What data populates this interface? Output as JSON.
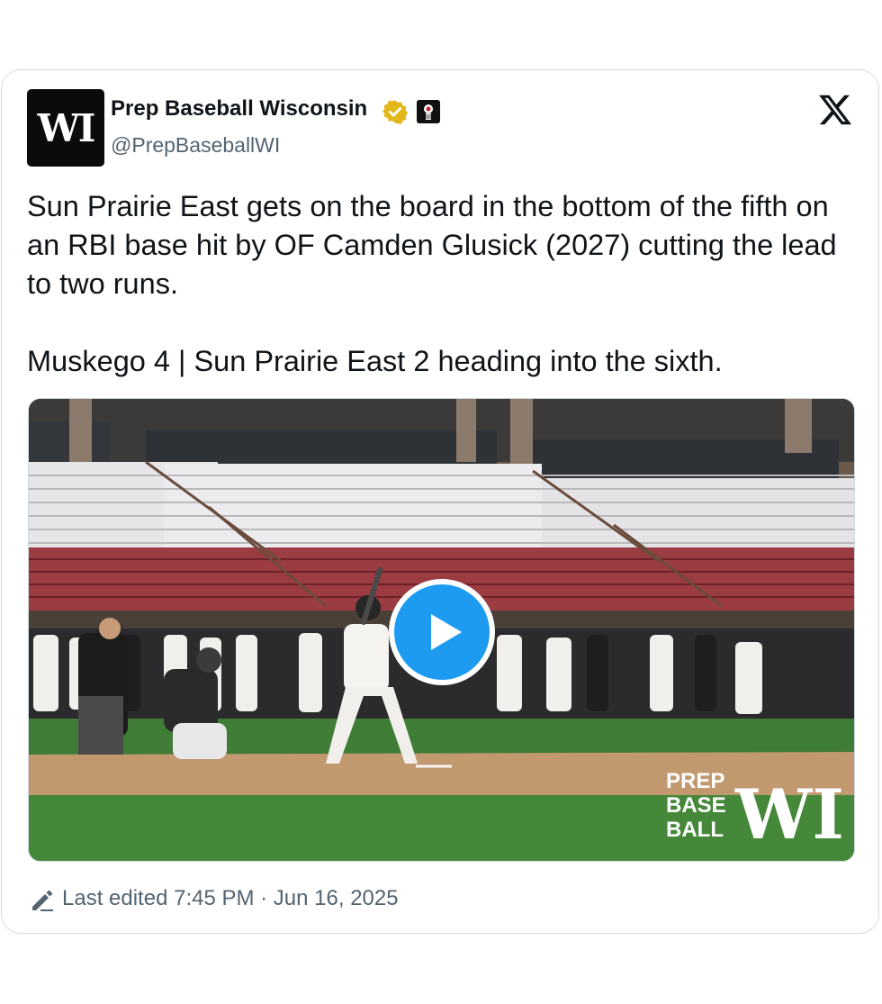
{
  "author": {
    "name": "Prep Baseball Wisconsin",
    "handle": "@PrepBaseballWI",
    "avatar_text": "WI",
    "verified": true
  },
  "tweet": {
    "paragraph1": "Sun Prairie East gets on the board in the bottom of the fifth on an RBI base hit by OF Camden Glusick (2027) cutting the lead to two runs.",
    "paragraph2": "Muskego 4 | Sun Prairie East 2 heading into the sixth."
  },
  "media": {
    "type": "video",
    "watermark_words": [
      "PREP",
      "BASE",
      "BALL",
      "WI"
    ]
  },
  "footer": {
    "edited_text": "Last edited 7:45 PM · Jun 16, 2025"
  },
  "colors": {
    "accent": "#1d9bf0",
    "text": "#0f1419",
    "muted": "#536471",
    "verified": "#e2b719"
  },
  "icons": [
    "verified-badge-icon",
    "affiliate-badge-icon",
    "x-logo-icon",
    "play-icon",
    "edit-pencil-icon"
  ]
}
